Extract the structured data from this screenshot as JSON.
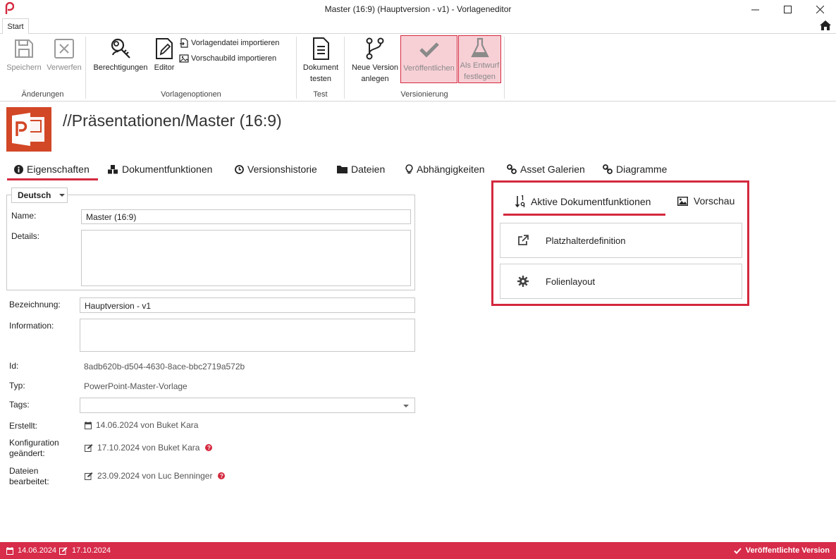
{
  "window": {
    "title": "Master (16:9) (Hauptversion - v1) - Vorlageneditor"
  },
  "tabstrip": {
    "start": "Start"
  },
  "ribbon": {
    "groups": {
      "aenderungen": "Änderungen",
      "vorlagenoptionen": "Vorlagenoptionen",
      "test": "Test",
      "versionierung": "Versionierung"
    },
    "buttons": {
      "speichern": "Speichern",
      "verwerfen": "Verwerfen",
      "berechtigungen": "Berechtigungen",
      "editor": "Editor",
      "vorlagendatei_importieren": "Vorlagendatei importieren",
      "vorschaubild_importieren": "Vorschaubild importieren",
      "dokument_testen_1": "Dokument",
      "dokument_testen_2": "testen",
      "neue_version_1": "Neue Version",
      "neue_version_2": "anlegen",
      "veroeffentlichen": "Veröffentlichen",
      "als_entwurf_1": "Als Entwurf",
      "als_entwurf_2": "festlegen"
    }
  },
  "header": {
    "title": "//Präsentationen/Master (16:9)"
  },
  "tabs": [
    {
      "label": "Eigenschaften",
      "icon": "info-icon"
    },
    {
      "label": "Dokumentfunktionen",
      "icon": "cubes-icon"
    },
    {
      "label": "Versionshistorie",
      "icon": "clock-icon"
    },
    {
      "label": "Dateien",
      "icon": "folder-icon"
    },
    {
      "label": "Abhängigkeiten",
      "icon": "lightbulb-icon"
    },
    {
      "label": "Asset Galerien",
      "icon": "link-icon"
    },
    {
      "label": "Diagramme",
      "icon": "link-icon"
    }
  ],
  "form": {
    "language": "Deutsch",
    "name_label": "Name:",
    "name_value": "Master (16:9)",
    "details_label": "Details:",
    "details_value": "",
    "bezeichnung_label": "Bezeichnung:",
    "bezeichnung_value": "Hauptversion - v1",
    "information_label": "Information:",
    "information_value": "",
    "id_label": "Id:",
    "id_value": "8adb620b-d504-4630-8ace-bbc2719a572b",
    "typ_label": "Typ:",
    "typ_value": "PowerPoint-Master-Vorlage",
    "tags_label": "Tags:",
    "tags_value": "",
    "erstellt_label": "Erstellt:",
    "erstellt_value": "14.06.2024 von Buket Kara",
    "konfig_label_1": "Konfiguration",
    "konfig_label_2": "geändert:",
    "konfig_value": "17.10.2024 von Buket Kara",
    "dateien_label_1": "Dateien",
    "dateien_label_2": "bearbeitet:",
    "dateien_value": "23.09.2024 von Luc Benninger",
    "help_glyph": "?"
  },
  "right_panel": {
    "tab_active": "Aktive Dokumentfunktionen",
    "tab_preview": "Vorschau",
    "items": [
      {
        "label": "Platzhalterdefinition",
        "icon": "external-link-icon"
      },
      {
        "label": "Folienlayout",
        "icon": "gear-icon"
      }
    ]
  },
  "statusbar": {
    "created": "14.06.2024",
    "modified": "17.10.2024",
    "status": "Veröffentlichte Version"
  },
  "colors": {
    "accent": "#d4283e",
    "status_bg": "#d72c4a",
    "ppt": "#d24726"
  }
}
